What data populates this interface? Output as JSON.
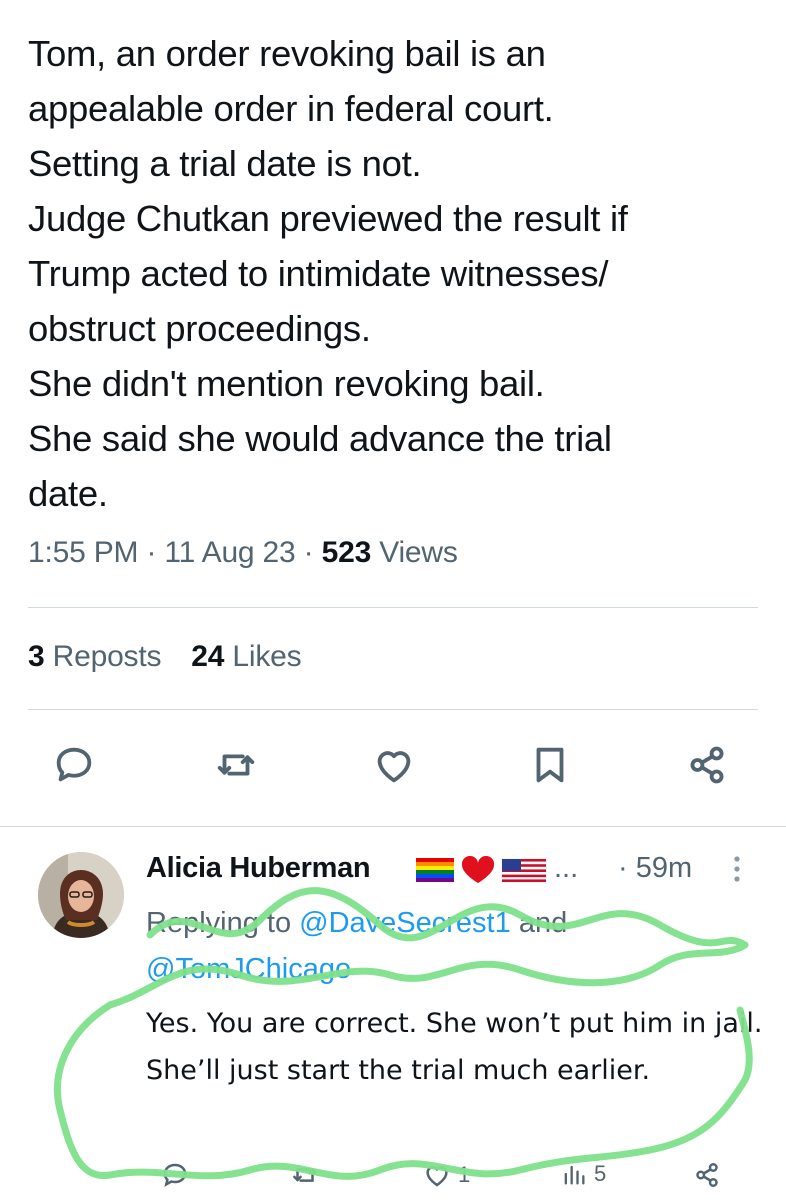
{
  "tweet": {
    "text": "Tom, an order revoking bail is an\nappealable order in federal court.\nSetting a trial date is not.\nJudge Chutkan previewed the result if\nTrump acted to intimidate witnesses/\nobstruct proceedings.\nShe didn't mention revoking bail.\nShe said she would advance the trial\ndate.",
    "time": "1:55 PM",
    "date": "11 Aug 23",
    "dot": "·",
    "views_count": "523",
    "views_label": "Views",
    "reposts_count": "3",
    "reposts_label": "Reposts",
    "likes_count": "24",
    "likes_label": "Likes"
  },
  "actions": {
    "icons": [
      "reply-icon",
      "repost-icon",
      "like-icon",
      "bookmark-icon",
      "share-icon"
    ]
  },
  "reply": {
    "author_name": "Alicia Huberman",
    "author_flags": [
      "rainbow-flag",
      "red-heart",
      "us-flag"
    ],
    "ellipsis": "...",
    "time": "· 59m",
    "replying_prefix": "Replying to",
    "mention_1": "@DaveSecrest1",
    "and_word": "and",
    "mention_2": "@TomJChicago",
    "text": "Yes. You are correct. She won’t put him in jail. She’ll just start the trial much earlier.",
    "likes": "1",
    "views": "5"
  },
  "colors": {
    "text": "#0f1419",
    "secondary": "#536471",
    "accent": "#1d9bf0",
    "divider": "#cfd9de",
    "highlight_scribble": "#7ee08a"
  }
}
